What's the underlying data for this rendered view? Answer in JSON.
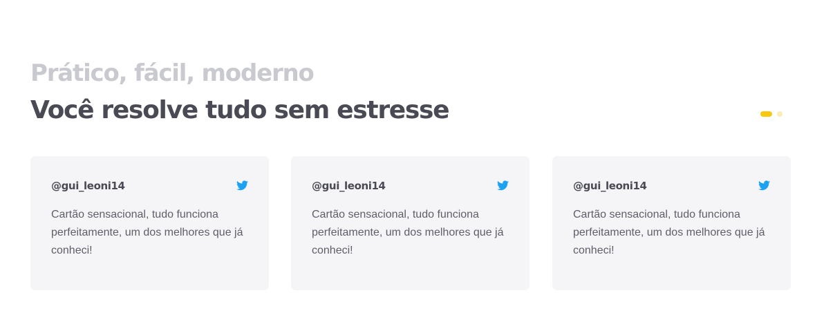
{
  "section": {
    "eyebrow": "Prático, fácil, moderno",
    "headline": "Você resolve tudo sem estresse"
  },
  "pager": {
    "pages": 2,
    "active_index": 0,
    "active_color": "#f6c90e",
    "inactive_color": "#fbeeb4"
  },
  "testimonials": [
    {
      "handle": "@gui_leoni14",
      "text": "Cartão sensacional, tudo funciona perfeitamente, um dos melhores que já conheci!",
      "icon": "twitter-icon"
    },
    {
      "handle": "@gui_leoni14",
      "text": "Cartão sensacional, tudo funciona perfeitamente, um dos melhores que já conheci!",
      "icon": "twitter-icon"
    },
    {
      "handle": "@gui_leoni14",
      "text": "Cartão sensacional, tudo funciona perfeitamente, um dos melhores que já conheci!",
      "icon": "twitter-icon"
    }
  ],
  "colors": {
    "twitter": "#1da1f2",
    "card_bg": "#f5f5f7"
  }
}
